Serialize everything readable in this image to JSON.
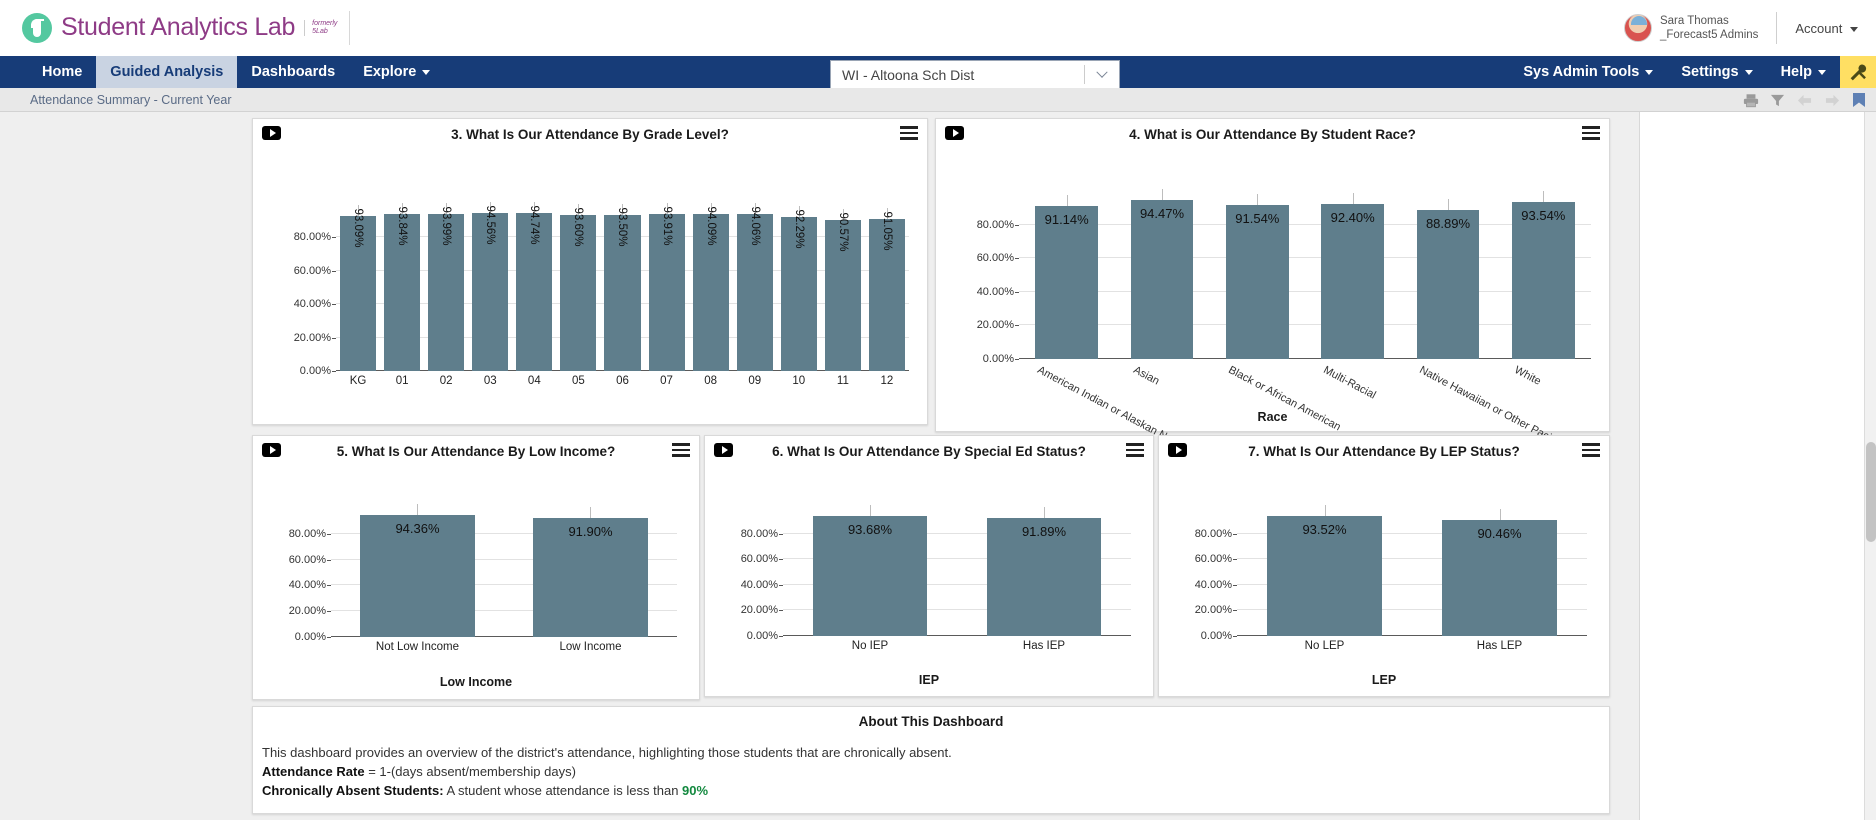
{
  "brand": {
    "name": "Student Analytics Lab",
    "formerly_line1": "formerly",
    "formerly_line2": "5Lab"
  },
  "account": {
    "user_line1": "Sara Thomas",
    "user_line2": "_Forecast5 Admins",
    "account_label": "Account"
  },
  "nav": {
    "left_items": [
      {
        "label": "Home",
        "active": false,
        "caret": false
      },
      {
        "label": "Guided Analysis",
        "active": true,
        "caret": false
      },
      {
        "label": "Dashboards",
        "active": false,
        "caret": false
      },
      {
        "label": "Explore",
        "active": false,
        "caret": true
      }
    ],
    "right_items": [
      {
        "label": "Sys Admin Tools",
        "caret": true
      },
      {
        "label": "Settings",
        "caret": true
      },
      {
        "label": "Help",
        "caret": true
      }
    ],
    "tools_icon": "wrench-screwdriver-icon",
    "district_value": "WI - Altoona Sch Dist"
  },
  "subbar": {
    "title": "Attendance Summary - Current Year",
    "icons": [
      "print-icon",
      "filter-icon",
      "arrow-left-icon",
      "arrow-right-icon",
      "bookmark-icon"
    ]
  },
  "chart_data": [
    {
      "id": "grade-level",
      "type": "bar",
      "title": "3. What Is Our Attendance By Grade Level?",
      "categories": [
        "KG",
        "01",
        "02",
        "03",
        "04",
        "05",
        "06",
        "07",
        "08",
        "09",
        "10",
        "11",
        "12"
      ],
      "values": [
        93.09,
        93.84,
        93.99,
        94.56,
        94.74,
        93.6,
        93.5,
        93.91,
        94.09,
        94.06,
        92.29,
        90.57,
        91.05
      ],
      "labels": [
        "93.09%",
        "93.84%",
        "93.99%",
        "94.56%",
        "94.74%",
        "93.60%",
        "93.50%",
        "93.91%",
        "94.09%",
        "94.06%",
        "92.29%",
        "90.57%",
        "91.05%"
      ],
      "xlabel": "",
      "ylabel": "",
      "yticks": [
        "0.00%",
        "20.00%",
        "40.00%",
        "60.00%",
        "80.00%"
      ],
      "ytickvals": [
        0,
        20,
        40,
        60,
        80
      ],
      "ylim": [
        0,
        100
      ],
      "grid": true,
      "label_orientation": "vertical",
      "bar_color": "#5f7e8c"
    },
    {
      "id": "student-race",
      "type": "bar",
      "title": "4. What is Our Attendance By Student Race?",
      "categories": [
        "American Indian or Alaskan Native",
        "Asian",
        "Black or African American",
        "Multi-Racial",
        "Native Hawaiian or Other Pacific Isla.",
        "White"
      ],
      "values": [
        91.14,
        94.47,
        91.54,
        92.4,
        88.89,
        93.54
      ],
      "labels": [
        "91.14%",
        "94.47%",
        "91.54%",
        "92.40%",
        "88.89%",
        "93.54%"
      ],
      "xlabel": "Race",
      "ylabel": "",
      "yticks": [
        "0.00%",
        "20.00%",
        "40.00%",
        "60.00%",
        "80.00%"
      ],
      "ytickvals": [
        0,
        20,
        40,
        60,
        80
      ],
      "ylim": [
        0,
        100
      ],
      "grid": true,
      "label_orientation": "horizontal",
      "bar_color": "#5f7e8c"
    },
    {
      "id": "low-income",
      "type": "bar",
      "title": "5. What Is Our Attendance By Low Income?",
      "categories": [
        "Not Low Income",
        "Low Income"
      ],
      "values": [
        94.36,
        91.9
      ],
      "labels": [
        "94.36%",
        "91.90%"
      ],
      "xlabel": "Low Income",
      "ylabel": "",
      "yticks": [
        "0.00%",
        "20.00%",
        "40.00%",
        "60.00%",
        "80.00%"
      ],
      "ytickvals": [
        0,
        20,
        40,
        60,
        80
      ],
      "ylim": [
        0,
        100
      ],
      "grid": true,
      "label_orientation": "horizontal",
      "bar_color": "#5f7e8c"
    },
    {
      "id": "special-ed",
      "type": "bar",
      "title": "6. What Is Our Attendance By Special Ed Status?",
      "categories": [
        "No IEP",
        "Has IEP"
      ],
      "values": [
        93.68,
        91.89
      ],
      "labels": [
        "93.68%",
        "91.89%"
      ],
      "xlabel": "IEP",
      "ylabel": "",
      "yticks": [
        "0.00%",
        "20.00%",
        "40.00%",
        "60.00%",
        "80.00%"
      ],
      "ytickvals": [
        0,
        20,
        40,
        60,
        80
      ],
      "ylim": [
        0,
        100
      ],
      "grid": true,
      "label_orientation": "horizontal",
      "bar_color": "#5f7e8c"
    },
    {
      "id": "lep-status",
      "type": "bar",
      "title": "7. What Is Our Attendance By LEP Status?",
      "categories": [
        "No LEP",
        "Has LEP"
      ],
      "values": [
        93.52,
        90.46
      ],
      "labels": [
        "93.52%",
        "90.46%"
      ],
      "xlabel": "LEP",
      "ylabel": "",
      "yticks": [
        "0.00%",
        "20.00%",
        "40.00%",
        "60.00%",
        "80.00%"
      ],
      "ytickvals": [
        0,
        20,
        40,
        60,
        80
      ],
      "ylim": [
        0,
        100
      ],
      "grid": true,
      "label_orientation": "horizontal",
      "bar_color": "#5f7e8c"
    }
  ],
  "about": {
    "title": "About This Dashboard",
    "line1": "This dashboard provides an overview of the district's attendance, highlighting those students that are chronically absent.",
    "line2_bold": "Attendance Rate",
    "line2_rest": " = 1-(days absent/membership days)",
    "line3_bold": "Chronically Absent Students:",
    "line3_rest": " A student whose attendance is less than ",
    "line3_highlight": "90%"
  },
  "colors": {
    "nav_blue": "#173c78",
    "accent_yellow": "#ffdf63",
    "bar": "#5f7e8c",
    "brand_purple": "#8e3b86",
    "brand_green": "#54c8a0",
    "highlight_green": "#13893f"
  }
}
